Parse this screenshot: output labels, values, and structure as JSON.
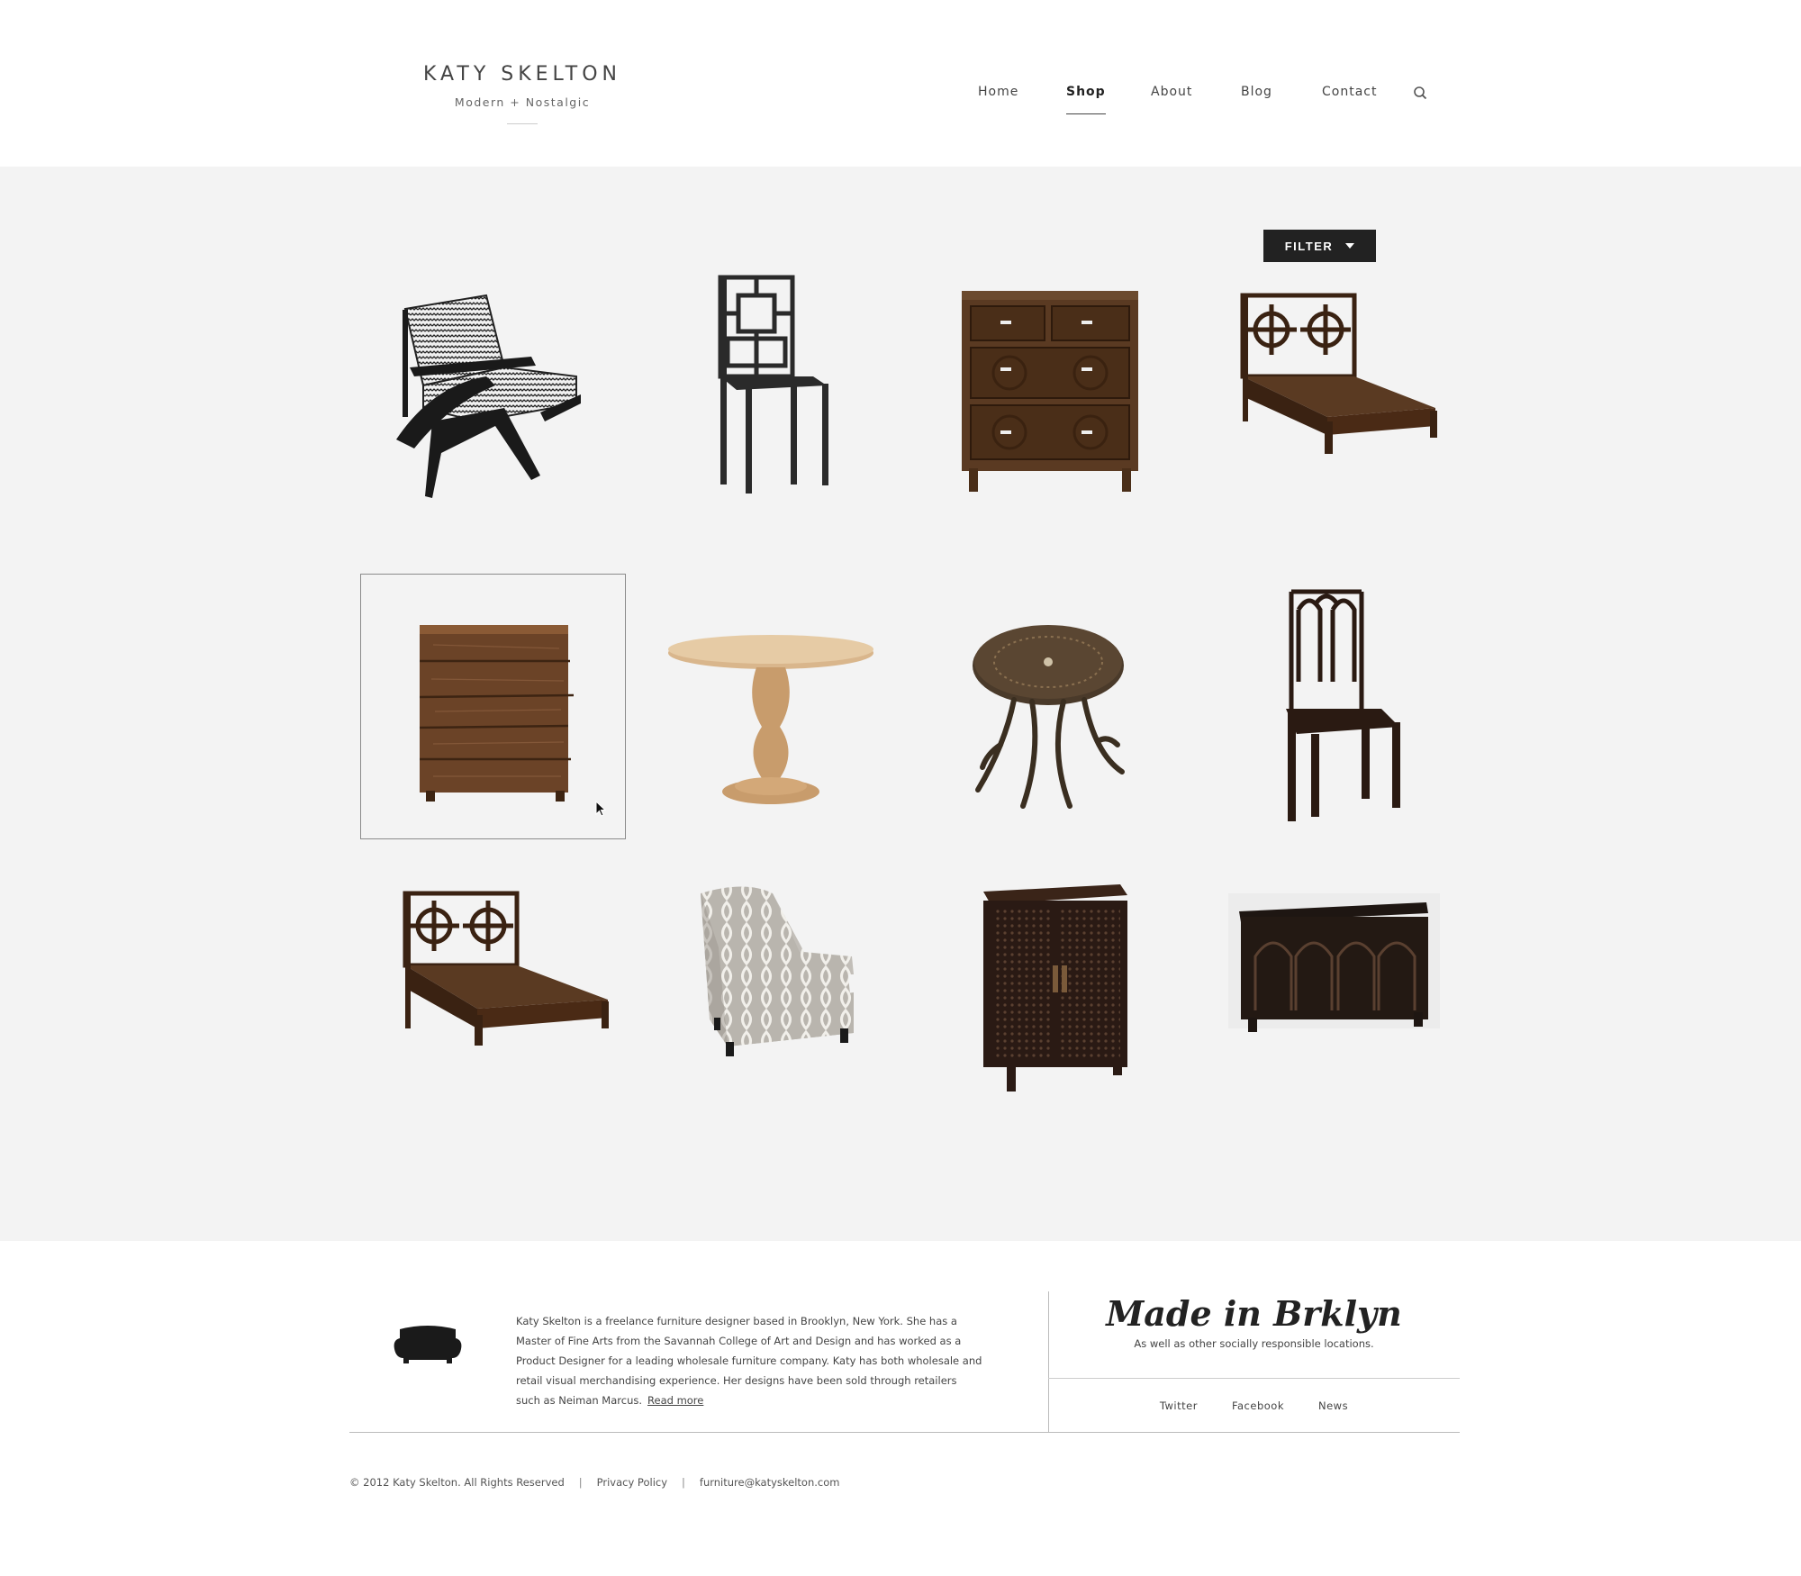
{
  "brand": {
    "name": "KATY SKELTON",
    "tagline": "Modern + Nostalgic"
  },
  "nav": {
    "items": [
      {
        "label": "Home",
        "active": false
      },
      {
        "label": "Shop",
        "active": true
      },
      {
        "label": "About",
        "active": false
      },
      {
        "label": "Blog",
        "active": false
      },
      {
        "label": "Contact",
        "active": false
      }
    ],
    "search_icon": "search-icon"
  },
  "shop": {
    "filter_label": "FILTER",
    "products": [
      {
        "name": "lounge-chair-patterned",
        "selected": false
      },
      {
        "name": "lattice-back-dining-chair",
        "selected": false
      },
      {
        "name": "carved-wood-dresser",
        "selected": false
      },
      {
        "name": "lattice-headboard-bed",
        "selected": false
      },
      {
        "name": "reclaimed-wood-nightstand",
        "selected": true
      },
      {
        "name": "round-pedestal-table",
        "selected": false
      },
      {
        "name": "antler-base-side-table",
        "selected": false
      },
      {
        "name": "tall-arch-back-chair",
        "selected": false
      },
      {
        "name": "lattice-headboard-bed-2",
        "selected": false
      },
      {
        "name": "ikat-armchair",
        "selected": false
      },
      {
        "name": "lattice-door-cabinet",
        "selected": false
      },
      {
        "name": "arched-door-sideboard",
        "selected": false
      }
    ]
  },
  "footer": {
    "about_text": "Katy Skelton is a freelance furniture designer based in Brooklyn, New York. She has a Master of Fine Arts from the Savannah College of Art and Design and has worked as a Product Designer for a leading wholesale furniture company. Katy has both wholesale and retail visual merchandising experience. Her designs have been sold through retailers such as Neiman Marcus.",
    "read_more": "Read more",
    "made_title": "Made in Brklyn",
    "made_subtitle": "As well as other socially responsible locations.",
    "social": [
      "Twitter",
      "Facebook",
      "News"
    ],
    "copyright": "© 2012 Katy Skelton. All Rights Reserved",
    "privacy": "Privacy Policy",
    "email": "furniture@katyskelton.com",
    "separator": "|"
  }
}
